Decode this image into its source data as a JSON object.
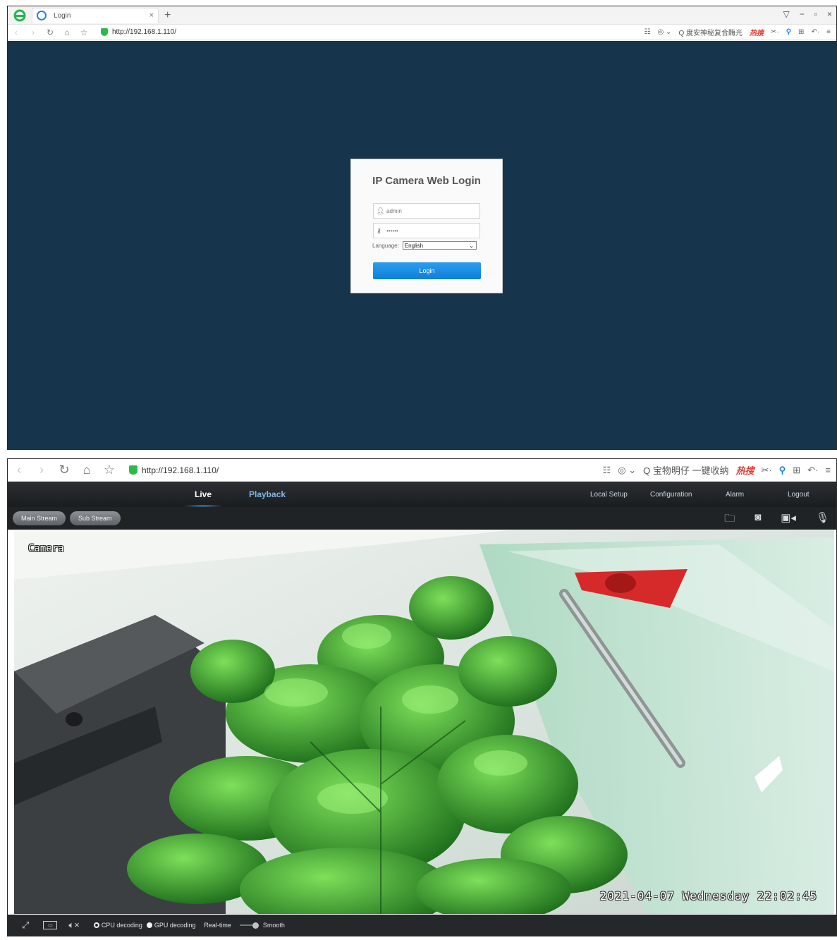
{
  "login_screen": {
    "browser": {
      "tab_title": "Login",
      "tab_close": "×",
      "new_tab": "+",
      "window_controls": [
        "▽",
        "−",
        "▫",
        "×"
      ],
      "url": "http://192.168.1.110/",
      "search_text": "Q 度安神秘复合酶光",
      "hot_tag": "热搜"
    },
    "title": "IP Camera Web Login",
    "username_value": "admin",
    "password_value": "••••••",
    "language_label": "Language:",
    "language_selected": "English",
    "login_button": "Login",
    "colors": {
      "background": "#17344d",
      "button": "#1588e0"
    }
  },
  "live_screen": {
    "browser": {
      "url": "http://192.168.1.110/",
      "search_text": "Q 宝物明仔 一键收纳",
      "hot_tag": "热搜"
    },
    "nav": {
      "live": "Live",
      "playback": "Playback",
      "local_setup": "Local Setup",
      "configuration": "Configuration",
      "alarm": "Alarm",
      "logout": "Logout"
    },
    "streams": {
      "main": "Main Stream",
      "sub": "Sub Stream"
    },
    "osd": {
      "camera_name": "Camera",
      "timestamp": "2021-04-07 Wednesday 22:02:45"
    },
    "controls": {
      "cpu_decoding": "CPU decoding",
      "gpu_decoding": "GPU decoding",
      "realtime": "Real-time",
      "smooth": "Smooth",
      "selected_decoding": "GPU decoding"
    }
  },
  "icons": {
    "browser": [
      "back-icon",
      "forward-icon",
      "refresh-icon",
      "home-icon",
      "favorite-icon",
      "shield-icon",
      "menu-icon"
    ],
    "toolbar": [
      "folder-search-icon",
      "snapshot-icon",
      "record-icon",
      "microphone-icon"
    ],
    "bottom": [
      "fullscreen-icon",
      "aspect-ratio-icon",
      "mute-icon"
    ]
  }
}
